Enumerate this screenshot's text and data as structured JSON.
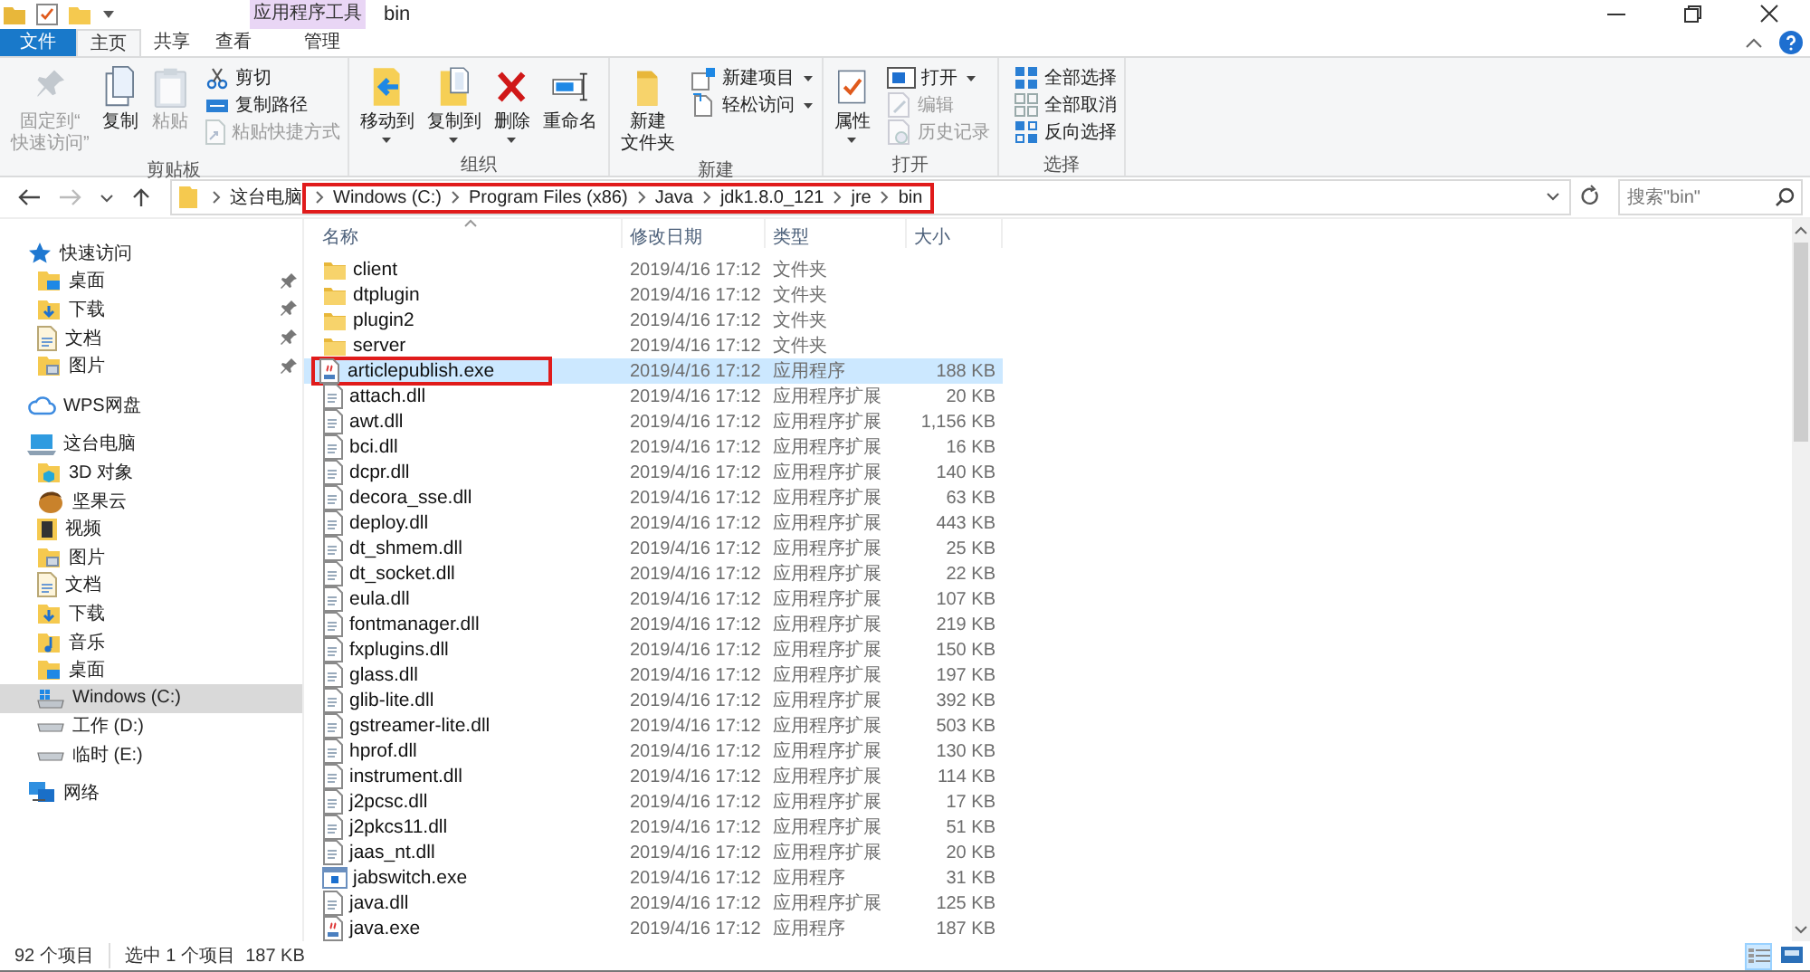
{
  "window": {
    "title": "bin",
    "context_tab": "应用程序工具"
  },
  "tabs": [
    {
      "label": "文件",
      "kind": "file",
      "selected": false
    },
    {
      "label": "主页",
      "kind": "normal",
      "selected": true
    },
    {
      "label": "共享",
      "kind": "normal",
      "selected": false
    },
    {
      "label": "查看",
      "kind": "normal",
      "selected": false
    },
    {
      "label": "管理",
      "kind": "context",
      "selected": false
    }
  ],
  "ribbon": [
    {
      "label": "剪贴板",
      "large": [
        {
          "lines": [
            "固定到“",
            "快速访问”"
          ],
          "kind": "pin",
          "disabled": true,
          "dropdown": false
        },
        {
          "lines": [
            "复制"
          ],
          "kind": "copy",
          "disabled": false,
          "dropdown": false
        },
        {
          "lines": [
            "粘贴"
          ],
          "kind": "paste",
          "disabled": true,
          "dropdown": false
        }
      ],
      "small": [
        {
          "label": "剪切",
          "kind": "cut",
          "disabled": false,
          "dropdown": false
        },
        {
          "label": "复制路径",
          "kind": "path",
          "disabled": false,
          "dropdown": false
        },
        {
          "label": "粘贴快捷方式",
          "kind": "shortcut",
          "disabled": true,
          "dropdown": false
        }
      ]
    },
    {
      "label": "组织",
      "large": [
        {
          "lines": [
            "移动到"
          ],
          "kind": "move",
          "disabled": false,
          "dropdown": true
        },
        {
          "lines": [
            "复制到"
          ],
          "kind": "copyto",
          "disabled": false,
          "dropdown": true
        },
        {
          "lines": [
            "删除"
          ],
          "kind": "delete",
          "disabled": false,
          "dropdown": true
        },
        {
          "lines": [
            "重命名"
          ],
          "kind": "rename",
          "disabled": false,
          "dropdown": false
        }
      ]
    },
    {
      "label": "新建",
      "large": [
        {
          "lines": [
            "新建",
            "文件夹"
          ],
          "kind": "newfolder",
          "disabled": false,
          "dropdown": false
        }
      ],
      "small": [
        {
          "label": "新建项目",
          "kind": "newitem",
          "disabled": false,
          "dropdown": true
        },
        {
          "label": "轻松访问",
          "kind": "easy",
          "disabled": false,
          "dropdown": true
        }
      ]
    },
    {
      "label": "打开",
      "large": [
        {
          "lines": [
            "属性"
          ],
          "kind": "props",
          "disabled": false,
          "dropdown": true
        }
      ],
      "small": [
        {
          "label": "打开",
          "kind": "open",
          "disabled": false,
          "dropdown": true
        },
        {
          "label": "编辑",
          "kind": "edit",
          "disabled": true,
          "dropdown": false
        },
        {
          "label": "历史记录",
          "kind": "history",
          "disabled": true,
          "dropdown": false
        }
      ]
    },
    {
      "label": "选择",
      "small": [
        {
          "label": "全部选择",
          "kind": "selall",
          "disabled": false,
          "dropdown": false
        },
        {
          "label": "全部取消",
          "kind": "selnone",
          "disabled": false,
          "dropdown": false
        },
        {
          "label": "反向选择",
          "kind": "invert",
          "disabled": false,
          "dropdown": false
        }
      ]
    }
  ],
  "address_bar": {
    "crumbs": [
      {
        "label": "这台电脑",
        "highlighted": false
      },
      {
        "label": "Windows (C:)",
        "highlighted": true
      },
      {
        "label": "Program Files (x86)",
        "highlighted": true
      },
      {
        "label": "Java",
        "highlighted": true
      },
      {
        "label": "jdk1.8.0_121",
        "highlighted": true
      },
      {
        "label": "jre",
        "highlighted": true
      },
      {
        "label": "bin",
        "highlighted": true
      }
    ],
    "search_placeholder": "搜索\"bin\""
  },
  "sidebar": [
    {
      "label": "快速访问",
      "kind": "star",
      "selected": false,
      "children": [
        {
          "label": "桌面",
          "kind": "desktop",
          "selected": false,
          "pinned": true
        },
        {
          "label": "下载",
          "kind": "download",
          "selected": false,
          "pinned": true
        },
        {
          "label": "文档",
          "kind": "docs",
          "selected": false,
          "pinned": true
        },
        {
          "label": "图片",
          "kind": "pictures",
          "selected": false,
          "pinned": true
        }
      ]
    },
    {
      "label": "WPS网盘",
      "kind": "cloud",
      "selected": false
    },
    {
      "label": "这台电脑",
      "kind": "pc",
      "selected": false,
      "children": [
        {
          "label": "3D 对象",
          "kind": "objects",
          "selected": false,
          "pinned": false
        },
        {
          "label": "坚果云",
          "kind": "nut",
          "selected": false,
          "pinned": false
        },
        {
          "label": "视频",
          "kind": "video",
          "selected": false,
          "pinned": false
        },
        {
          "label": "图片",
          "kind": "pictures",
          "selected": false,
          "pinned": false
        },
        {
          "label": "文档",
          "kind": "docs",
          "selected": false,
          "pinned": false
        },
        {
          "label": "下载",
          "kind": "download",
          "selected": false,
          "pinned": false
        },
        {
          "label": "音乐",
          "kind": "music",
          "selected": false,
          "pinned": false
        },
        {
          "label": "桌面",
          "kind": "desktop",
          "selected": false,
          "pinned": false
        },
        {
          "label": "Windows (C:)",
          "kind": "sysdrive",
          "selected": true,
          "pinned": false
        },
        {
          "label": "工作 (D:)",
          "kind": "drive",
          "selected": false,
          "pinned": false
        },
        {
          "label": "临时 (E:)",
          "kind": "drive",
          "selected": false,
          "pinned": false
        }
      ]
    },
    {
      "label": "网络",
      "kind": "network",
      "selected": false
    }
  ],
  "table": {
    "columns": [
      "名称",
      "修改日期",
      "类型",
      "大小"
    ],
    "rows": [
      {
        "name": "client",
        "kind": "folder",
        "date": "2019/4/16 17:12",
        "type": "文件夹",
        "selected": false,
        "highlighted": false
      },
      {
        "name": "dtplugin",
        "kind": "folder",
        "date": "2019/4/16 17:12",
        "type": "文件夹",
        "selected": false,
        "highlighted": false
      },
      {
        "name": "plugin2",
        "kind": "folder",
        "date": "2019/4/16 17:12",
        "type": "文件夹",
        "selected": false,
        "highlighted": false
      },
      {
        "name": "server",
        "kind": "folder",
        "date": "2019/4/16 17:12",
        "type": "文件夹",
        "selected": false,
        "highlighted": false
      },
      {
        "name": "articlepublish.exe",
        "kind": "java",
        "date": "2019/4/16 17:12",
        "type": "应用程序",
        "size": "188 KB",
        "selected": true,
        "highlighted": true
      },
      {
        "name": "attach.dll",
        "kind": "dll",
        "date": "2019/4/16 17:12",
        "type": "应用程序扩展",
        "size": "20 KB",
        "selected": false,
        "highlighted": false
      },
      {
        "name": "awt.dll",
        "kind": "dll",
        "date": "2019/4/16 17:12",
        "type": "应用程序扩展",
        "size": "1,156 KB",
        "selected": false,
        "highlighted": false
      },
      {
        "name": "bci.dll",
        "kind": "dll",
        "date": "2019/4/16 17:12",
        "type": "应用程序扩展",
        "size": "16 KB",
        "selected": false,
        "highlighted": false
      },
      {
        "name": "dcpr.dll",
        "kind": "dll",
        "date": "2019/4/16 17:12",
        "type": "应用程序扩展",
        "size": "140 KB",
        "selected": false,
        "highlighted": false
      },
      {
        "name": "decora_sse.dll",
        "kind": "dll",
        "date": "2019/4/16 17:12",
        "type": "应用程序扩展",
        "size": "63 KB",
        "selected": false,
        "highlighted": false
      },
      {
        "name": "deploy.dll",
        "kind": "dll",
        "date": "2019/4/16 17:12",
        "type": "应用程序扩展",
        "size": "443 KB",
        "selected": false,
        "highlighted": false
      },
      {
        "name": "dt_shmem.dll",
        "kind": "dll",
        "date": "2019/4/16 17:12",
        "type": "应用程序扩展",
        "size": "25 KB",
        "selected": false,
        "highlighted": false
      },
      {
        "name": "dt_socket.dll",
        "kind": "dll",
        "date": "2019/4/16 17:12",
        "type": "应用程序扩展",
        "size": "22 KB",
        "selected": false,
        "highlighted": false
      },
      {
        "name": "eula.dll",
        "kind": "dll",
        "date": "2019/4/16 17:12",
        "type": "应用程序扩展",
        "size": "107 KB",
        "selected": false,
        "highlighted": false
      },
      {
        "name": "fontmanager.dll",
        "kind": "dll",
        "date": "2019/4/16 17:12",
        "type": "应用程序扩展",
        "size": "219 KB",
        "selected": false,
        "highlighted": false
      },
      {
        "name": "fxplugins.dll",
        "kind": "dll",
        "date": "2019/4/16 17:12",
        "type": "应用程序扩展",
        "size": "150 KB",
        "selected": false,
        "highlighted": false
      },
      {
        "name": "glass.dll",
        "kind": "dll",
        "date": "2019/4/16 17:12",
        "type": "应用程序扩展",
        "size": "197 KB",
        "selected": false,
        "highlighted": false
      },
      {
        "name": "glib-lite.dll",
        "kind": "dll",
        "date": "2019/4/16 17:12",
        "type": "应用程序扩展",
        "size": "392 KB",
        "selected": false,
        "highlighted": false
      },
      {
        "name": "gstreamer-lite.dll",
        "kind": "dll",
        "date": "2019/4/16 17:12",
        "type": "应用程序扩展",
        "size": "503 KB",
        "selected": false,
        "highlighted": false
      },
      {
        "name": "hprof.dll",
        "kind": "dll",
        "date": "2019/4/16 17:12",
        "type": "应用程序扩展",
        "size": "130 KB",
        "selected": false,
        "highlighted": false
      },
      {
        "name": "instrument.dll",
        "kind": "dll",
        "date": "2019/4/16 17:12",
        "type": "应用程序扩展",
        "size": "114 KB",
        "selected": false,
        "highlighted": false
      },
      {
        "name": "j2pcsc.dll",
        "kind": "dll",
        "date": "2019/4/16 17:12",
        "type": "应用程序扩展",
        "size": "17 KB",
        "selected": false,
        "highlighted": false
      },
      {
        "name": "j2pkcs11.dll",
        "kind": "dll",
        "date": "2019/4/16 17:12",
        "type": "应用程序扩展",
        "size": "51 KB",
        "selected": false,
        "highlighted": false
      },
      {
        "name": "jaas_nt.dll",
        "kind": "dll",
        "date": "2019/4/16 17:12",
        "type": "应用程序扩展",
        "size": "20 KB",
        "selected": false,
        "highlighted": false
      },
      {
        "name": "jabswitch.exe",
        "kind": "app",
        "date": "2019/4/16 17:12",
        "type": "应用程序",
        "size": "31 KB",
        "selected": false,
        "highlighted": false
      },
      {
        "name": "java.dll",
        "kind": "dll",
        "date": "2019/4/16 17:12",
        "type": "应用程序扩展",
        "size": "125 KB",
        "selected": false,
        "highlighted": false
      },
      {
        "name": "java.exe",
        "kind": "java",
        "date": "2019/4/16 17:12",
        "type": "应用程序",
        "size": "187 KB",
        "selected": false,
        "highlighted": false
      }
    ]
  },
  "status_bar": {
    "item_count": "92 个项目",
    "selection": "选中 1 个项目  187 KB"
  },
  "view_buttons": [
    {
      "kind": "details",
      "selected": true
    },
    {
      "kind": "large",
      "selected": false
    }
  ]
}
